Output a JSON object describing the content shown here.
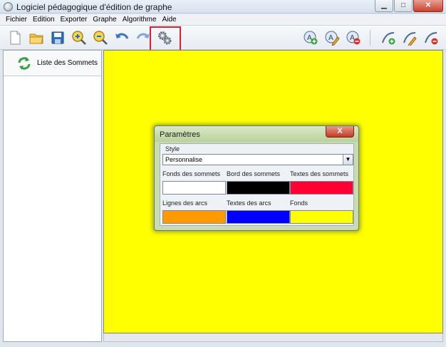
{
  "window": {
    "title": "Logiciel pédagogique d'édition de graphe",
    "minimize_glyph": "▁",
    "maximize_glyph": "□",
    "close_glyph": "✕"
  },
  "menu": [
    "Fichier",
    "Edition",
    "Exporter",
    "Graphe",
    "Algorithme",
    "Aide"
  ],
  "toolbar": {
    "icons": [
      "new-file-icon",
      "open-folder-icon",
      "save-icon",
      "zoom-in-icon",
      "zoom-out-icon",
      "undo-icon",
      "redo-icon",
      "settings-gears-icon",
      "add-vertex-icon",
      "edit-vertex-icon",
      "delete-vertex-icon",
      "add-arc-icon",
      "edit-arc-icon",
      "delete-arc-icon"
    ]
  },
  "left_panel": {
    "title": "Liste des Sommets",
    "icon": "refresh-icon"
  },
  "canvas": {
    "background": "#ffff00"
  },
  "dialog": {
    "title": "Paramètres",
    "close_glyph": "X",
    "style_label": "Style",
    "style_value": "Personnalise",
    "fields": [
      {
        "label": "Fonds des sommets",
        "color": "#ffffff"
      },
      {
        "label": "Bord des sommets",
        "color": "#000000"
      },
      {
        "label": "Textes des sommets",
        "color": "#ff0033"
      },
      {
        "label": "Lignes des arcs",
        "color": "#ff9900"
      },
      {
        "label": "Textes des arcs",
        "color": "#0000ff"
      },
      {
        "label": "Fonds",
        "color": "#ffff00"
      }
    ]
  }
}
